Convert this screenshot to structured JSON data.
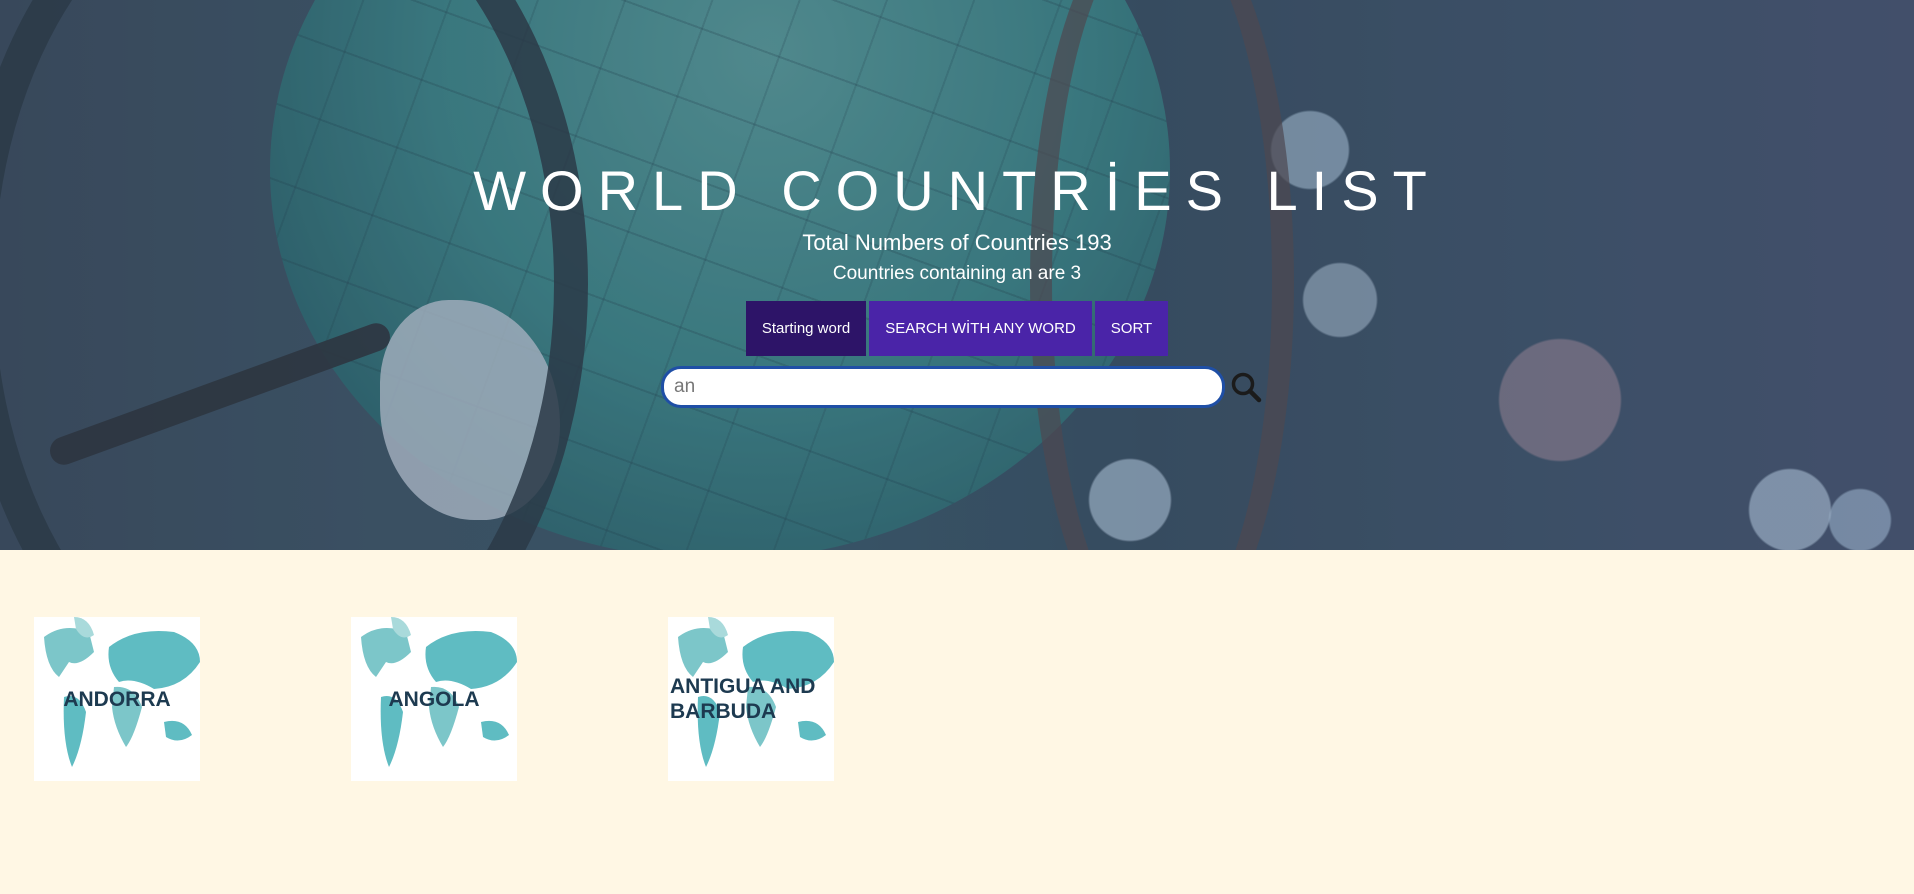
{
  "header": {
    "title": "WORLD COUNTRİES LIST",
    "total_text": "Total Numbers of Countries 193",
    "containing_text": "Countries containing an are 3"
  },
  "buttons": [
    {
      "label": "Starting word",
      "active": true
    },
    {
      "label": "SEARCH WİTH ANY WORD",
      "active": false
    },
    {
      "label": "SORT",
      "active": false
    }
  ],
  "search": {
    "value": "an",
    "icon": "search-icon"
  },
  "countries": [
    {
      "name": "ANDORRA"
    },
    {
      "name": "ANGOLA"
    },
    {
      "name": "ANTIGUA AND BARBUDA"
    }
  ],
  "colors": {
    "page_background": "#fff7e4",
    "active_button": "#2d1468",
    "button": "#4a24a8",
    "map_teal": "#5fbcc2",
    "country_text": "#1d3a50"
  }
}
